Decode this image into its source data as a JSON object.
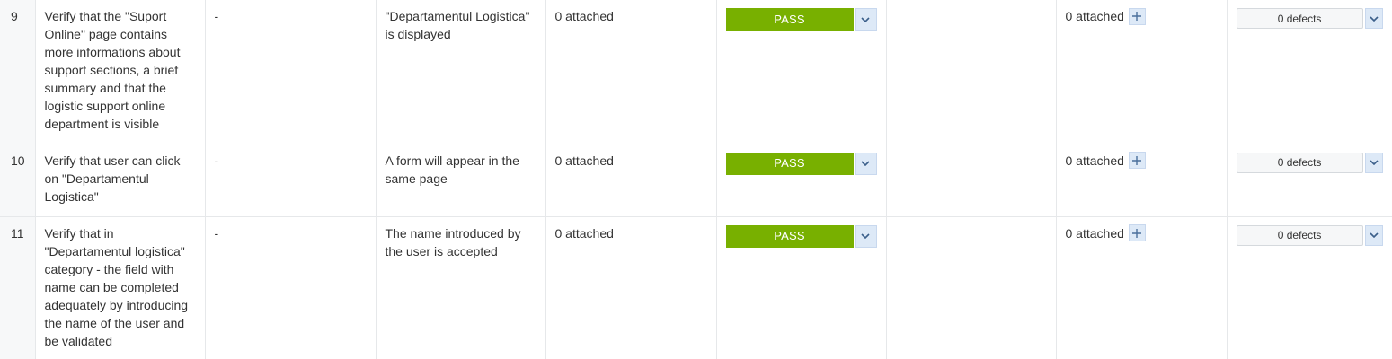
{
  "rows": [
    {
      "num": "9",
      "step": "Verify that the \"Suport Online\" page contains more informations about support sections, a brief summary and that the logistic support online department is visible",
      "data": "-",
      "expected": "\"Departamentul Logistica\" is displayed",
      "attachments": "0 attached",
      "status": "PASS",
      "result_attachments": "0 attached",
      "defects": "0 defects"
    },
    {
      "num": "10",
      "step": "Verify that user can click on \"Departamentul Logistica\"",
      "data": "-",
      "expected": "A form will appear in the same page",
      "attachments": "0 attached",
      "status": "PASS",
      "result_attachments": "0 attached",
      "defects": "0 defects"
    },
    {
      "num": "11",
      "step": "Verify that in \"Departamentul logistica\" category - the field with name can be completed adequately by introducing the name of the user and be validated",
      "data": "-",
      "expected": "The name introduced by the user is accepted",
      "attachments": "0 attached",
      "status": "PASS",
      "result_attachments": "0 attached",
      "defects": "0 defects"
    }
  ],
  "colors": {
    "pass": "#78b000",
    "dropdown": "#dde9f7",
    "border": "#e6e8ea"
  },
  "icons": {
    "status_dropdown": "chevron-down-icon",
    "attach": "plus-icon",
    "defects_dropdown": "chevron-down-icon"
  }
}
